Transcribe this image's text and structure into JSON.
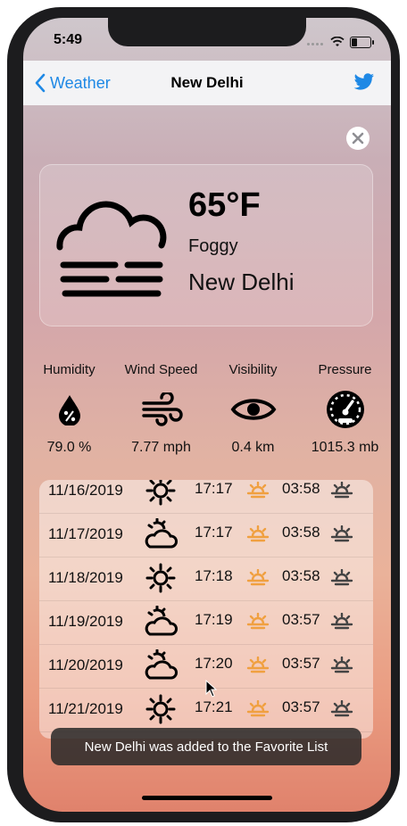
{
  "status_bar": {
    "time": "5:49"
  },
  "nav": {
    "back_label": "Weather",
    "title": "New Delhi"
  },
  "current": {
    "temperature": "65°F",
    "condition": "Foggy",
    "city": "New Delhi"
  },
  "metrics": [
    {
      "label": "Humidity",
      "value": "79.0 %",
      "icon": "humidity-drop-icon"
    },
    {
      "label": "Wind Speed",
      "value": "7.77 mph",
      "icon": "wind-icon"
    },
    {
      "label": "Visibility",
      "value": "0.4 km",
      "icon": "eye-icon"
    },
    {
      "label": "Pressure",
      "value": "1015.3 mb",
      "icon": "gauge-icon"
    }
  ],
  "forecast": [
    {
      "date": "11/16/2019",
      "icon": "sun-icon",
      "sunrise": "17:17",
      "sunset": "03:58"
    },
    {
      "date": "11/17/2019",
      "icon": "partly-cloudy-icon",
      "sunrise": "17:17",
      "sunset": "03:58"
    },
    {
      "date": "11/18/2019",
      "icon": "sun-icon",
      "sunrise": "17:18",
      "sunset": "03:58"
    },
    {
      "date": "11/19/2019",
      "icon": "partly-cloudy-icon",
      "sunrise": "17:19",
      "sunset": "03:57"
    },
    {
      "date": "11/20/2019",
      "icon": "partly-cloudy-icon",
      "sunrise": "17:20",
      "sunset": "03:57"
    },
    {
      "date": "11/21/2019",
      "icon": "sun-icon",
      "sunrise": "17:21",
      "sunset": "03:57"
    }
  ],
  "toast": {
    "message": "New Delhi was added to the Favorite List"
  },
  "colors": {
    "accent": "#1e88e5",
    "sunrise": "#f0a040",
    "text": "#111111"
  }
}
